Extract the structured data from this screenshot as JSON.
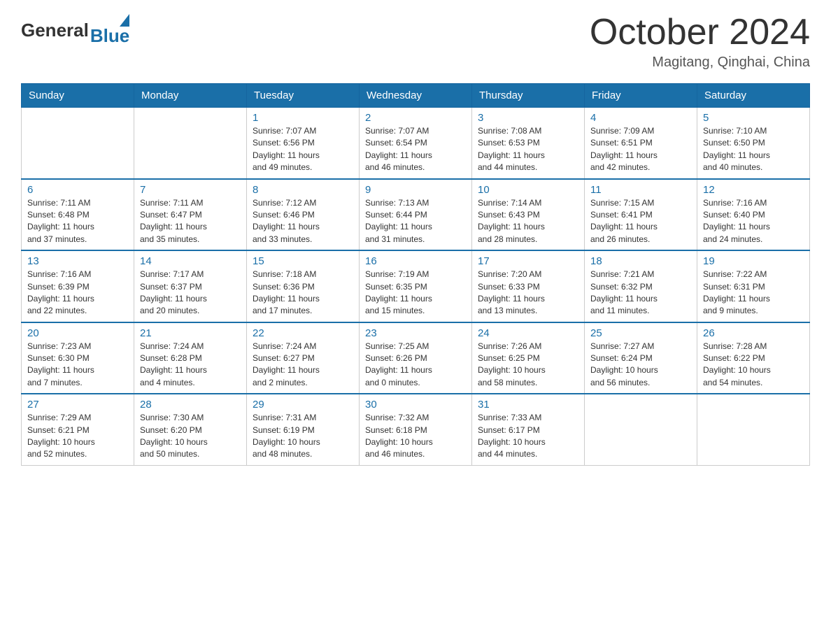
{
  "logo": {
    "general": "General",
    "blue": "Blue"
  },
  "title": "October 2024",
  "location": "Magitang, Qinghai, China",
  "headers": [
    "Sunday",
    "Monday",
    "Tuesday",
    "Wednesday",
    "Thursday",
    "Friday",
    "Saturday"
  ],
  "weeks": [
    [
      {
        "day": "",
        "info": ""
      },
      {
        "day": "",
        "info": ""
      },
      {
        "day": "1",
        "info": "Sunrise: 7:07 AM\nSunset: 6:56 PM\nDaylight: 11 hours\nand 49 minutes."
      },
      {
        "day": "2",
        "info": "Sunrise: 7:07 AM\nSunset: 6:54 PM\nDaylight: 11 hours\nand 46 minutes."
      },
      {
        "day": "3",
        "info": "Sunrise: 7:08 AM\nSunset: 6:53 PM\nDaylight: 11 hours\nand 44 minutes."
      },
      {
        "day": "4",
        "info": "Sunrise: 7:09 AM\nSunset: 6:51 PM\nDaylight: 11 hours\nand 42 minutes."
      },
      {
        "day": "5",
        "info": "Sunrise: 7:10 AM\nSunset: 6:50 PM\nDaylight: 11 hours\nand 40 minutes."
      }
    ],
    [
      {
        "day": "6",
        "info": "Sunrise: 7:11 AM\nSunset: 6:48 PM\nDaylight: 11 hours\nand 37 minutes."
      },
      {
        "day": "7",
        "info": "Sunrise: 7:11 AM\nSunset: 6:47 PM\nDaylight: 11 hours\nand 35 minutes."
      },
      {
        "day": "8",
        "info": "Sunrise: 7:12 AM\nSunset: 6:46 PM\nDaylight: 11 hours\nand 33 minutes."
      },
      {
        "day": "9",
        "info": "Sunrise: 7:13 AM\nSunset: 6:44 PM\nDaylight: 11 hours\nand 31 minutes."
      },
      {
        "day": "10",
        "info": "Sunrise: 7:14 AM\nSunset: 6:43 PM\nDaylight: 11 hours\nand 28 minutes."
      },
      {
        "day": "11",
        "info": "Sunrise: 7:15 AM\nSunset: 6:41 PM\nDaylight: 11 hours\nand 26 minutes."
      },
      {
        "day": "12",
        "info": "Sunrise: 7:16 AM\nSunset: 6:40 PM\nDaylight: 11 hours\nand 24 minutes."
      }
    ],
    [
      {
        "day": "13",
        "info": "Sunrise: 7:16 AM\nSunset: 6:39 PM\nDaylight: 11 hours\nand 22 minutes."
      },
      {
        "day": "14",
        "info": "Sunrise: 7:17 AM\nSunset: 6:37 PM\nDaylight: 11 hours\nand 20 minutes."
      },
      {
        "day": "15",
        "info": "Sunrise: 7:18 AM\nSunset: 6:36 PM\nDaylight: 11 hours\nand 17 minutes."
      },
      {
        "day": "16",
        "info": "Sunrise: 7:19 AM\nSunset: 6:35 PM\nDaylight: 11 hours\nand 15 minutes."
      },
      {
        "day": "17",
        "info": "Sunrise: 7:20 AM\nSunset: 6:33 PM\nDaylight: 11 hours\nand 13 minutes."
      },
      {
        "day": "18",
        "info": "Sunrise: 7:21 AM\nSunset: 6:32 PM\nDaylight: 11 hours\nand 11 minutes."
      },
      {
        "day": "19",
        "info": "Sunrise: 7:22 AM\nSunset: 6:31 PM\nDaylight: 11 hours\nand 9 minutes."
      }
    ],
    [
      {
        "day": "20",
        "info": "Sunrise: 7:23 AM\nSunset: 6:30 PM\nDaylight: 11 hours\nand 7 minutes."
      },
      {
        "day": "21",
        "info": "Sunrise: 7:24 AM\nSunset: 6:28 PM\nDaylight: 11 hours\nand 4 minutes."
      },
      {
        "day": "22",
        "info": "Sunrise: 7:24 AM\nSunset: 6:27 PM\nDaylight: 11 hours\nand 2 minutes."
      },
      {
        "day": "23",
        "info": "Sunrise: 7:25 AM\nSunset: 6:26 PM\nDaylight: 11 hours\nand 0 minutes."
      },
      {
        "day": "24",
        "info": "Sunrise: 7:26 AM\nSunset: 6:25 PM\nDaylight: 10 hours\nand 58 minutes."
      },
      {
        "day": "25",
        "info": "Sunrise: 7:27 AM\nSunset: 6:24 PM\nDaylight: 10 hours\nand 56 minutes."
      },
      {
        "day": "26",
        "info": "Sunrise: 7:28 AM\nSunset: 6:22 PM\nDaylight: 10 hours\nand 54 minutes."
      }
    ],
    [
      {
        "day": "27",
        "info": "Sunrise: 7:29 AM\nSunset: 6:21 PM\nDaylight: 10 hours\nand 52 minutes."
      },
      {
        "day": "28",
        "info": "Sunrise: 7:30 AM\nSunset: 6:20 PM\nDaylight: 10 hours\nand 50 minutes."
      },
      {
        "day": "29",
        "info": "Sunrise: 7:31 AM\nSunset: 6:19 PM\nDaylight: 10 hours\nand 48 minutes."
      },
      {
        "day": "30",
        "info": "Sunrise: 7:32 AM\nSunset: 6:18 PM\nDaylight: 10 hours\nand 46 minutes."
      },
      {
        "day": "31",
        "info": "Sunrise: 7:33 AM\nSunset: 6:17 PM\nDaylight: 10 hours\nand 44 minutes."
      },
      {
        "day": "",
        "info": ""
      },
      {
        "day": "",
        "info": ""
      }
    ]
  ]
}
